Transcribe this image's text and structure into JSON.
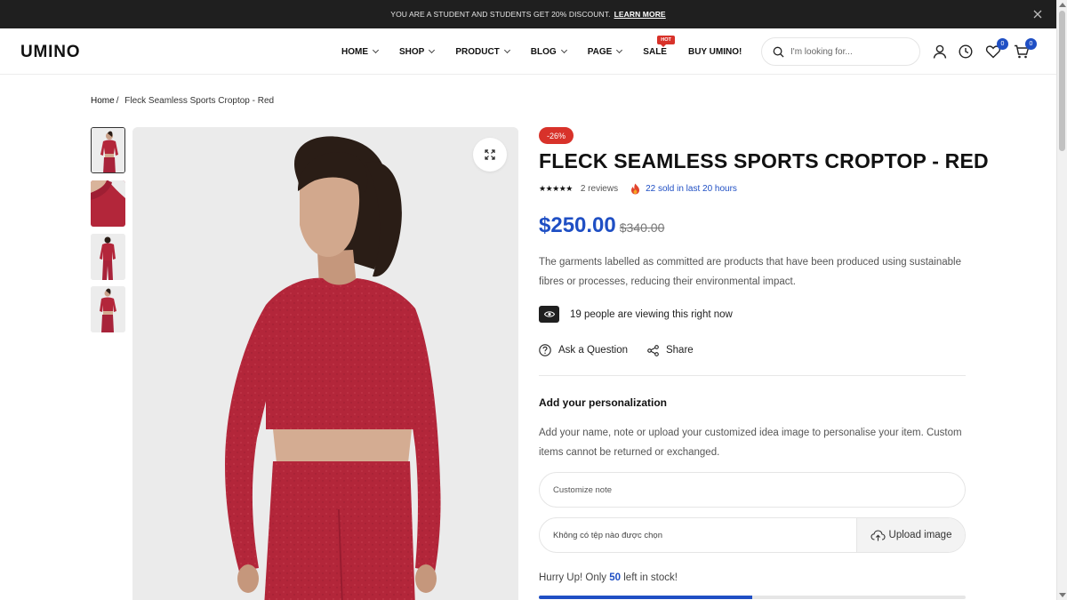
{
  "announcement": {
    "text": "YOU ARE A STUDENT AND STUDENTS GET 20% DISCOUNT.",
    "link": "LEARN MORE"
  },
  "header": {
    "logo": "UMINO",
    "nav": [
      {
        "label": "HOME",
        "dropdown": true
      },
      {
        "label": "SHOP",
        "dropdown": true
      },
      {
        "label": "PRODUCT",
        "dropdown": true
      },
      {
        "label": "BLOG",
        "dropdown": true
      },
      {
        "label": "PAGE",
        "dropdown": true
      },
      {
        "label": "SALE",
        "badge": "HOT"
      },
      {
        "label": "BUY UMINO!"
      }
    ],
    "search_placeholder": "I'm looking for...",
    "wishlist_count": "0",
    "cart_count": "0"
  },
  "breadcrumb": {
    "home": "Home",
    "separator": "/",
    "current": "Fleck Seamless Sports Croptop - Red"
  },
  "product": {
    "discount_badge": "-26%",
    "title": "FLECK SEAMLESS SPORTS CROPTOP - RED",
    "stars": "★★★★★",
    "reviews": "2 reviews",
    "sold": "22 sold in last 20 hours",
    "price": "$250.00",
    "old_price": "$340.00",
    "description": "The garments labelled as committed are products that have been produced using sustainable fibres or processes, reducing their environmental impact.",
    "viewing": "19 people are viewing this right now",
    "ask_question": "Ask a Question",
    "share": "Share"
  },
  "personalization": {
    "title": "Add your personalization",
    "description": "Add your name, note or upload your customized idea image to personalise your item. Custom items cannot be returned or exchanged.",
    "note_placeholder": "Customize note",
    "file_label": "Không có tệp nào được chọn",
    "upload_label": "Upload image"
  },
  "stock": {
    "prefix": "Hurry Up! Only",
    "count": "50",
    "suffix": "left in stock!",
    "fill_fraction": 0.5
  },
  "colors": {
    "accent": "#1f4fc4",
    "sale_red": "#d8322a",
    "product_red": "#b3263a"
  }
}
